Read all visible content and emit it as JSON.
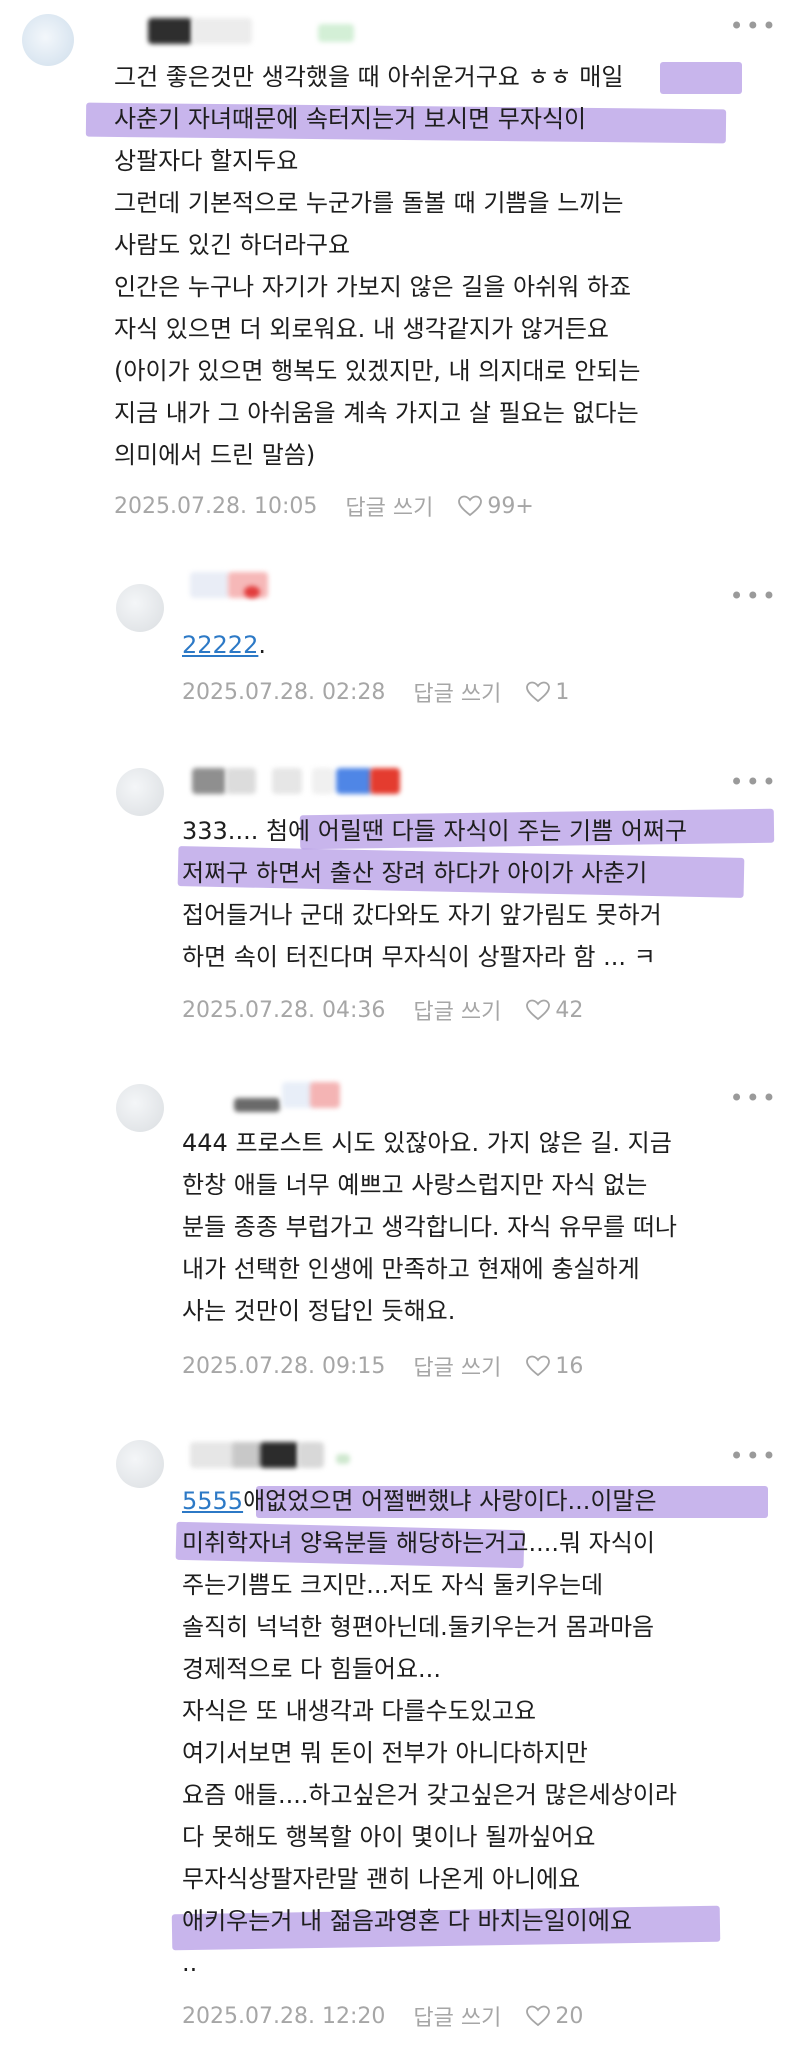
{
  "comments": [
    {
      "lines": [
        "그건 좋은것만 생각했을 때 아쉬운거구요 ㅎㅎ 매일",
        "사춘기 자녀때문에 속터지는거 보시면 무자식이",
        "상팔자다 할지두요",
        "그런데 기본적으로 누군가를 돌볼 때 기쁨을 느끼는",
        "사람도 있긴 하더라구요",
        "인간은 누구나 자기가 가보지 않은 길을 아쉬워 하죠",
        "자식 있으면 더 외로워요. 내 생각같지가 않거든요",
        "(아이가 있으면 행복도 있겠지만, 내 의지대로 안되는",
        "지금 내가 그 아쉬움을 계속 가지고 살 필요는 없다는",
        "의미에서 드린 말씀)"
      ],
      "date": "2025.07.28. 10:05",
      "reply": "답글 쓰기",
      "likes": "99+"
    },
    {
      "link": "22222",
      "lines": [
        "."
      ],
      "date": "2025.07.28. 02:28",
      "reply": "답글 쓰기",
      "likes": "1"
    },
    {
      "lines": [
        "333.... 첨에 어릴땐 다들 자식이 주는 기쁨 어쩌구",
        "저쩌구 하면서 출산 장려 하다가 아이가 사춘기",
        "접어들거나 군대 갔다와도 자기 앞가림도 못하거",
        "하면 속이 터진다며 무자식이 상팔자라 함 ... ㅋ"
      ],
      "date": "2025.07.28. 04:36",
      "reply": "답글 쓰기",
      "likes": "42"
    },
    {
      "lines": [
        "444 프로스트 시도 있잖아요. 가지 않은 길. 지금",
        "한창 애들 너무 예쁘고 사랑스럽지만 자식 없는",
        "분들 종종 부럽가고 생각합니다. 자식 유무를 떠나",
        "내가 선택한 인생에 만족하고 현재에 충실하게",
        "사는 것만이 정답인 듯해요."
      ],
      "date": "2025.07.28. 09:15",
      "reply": "답글 쓰기",
      "likes": "16"
    },
    {
      "link": "5555",
      "lines": [
        "애없었으면 어쩔뻔했냐 사랑이다...이말은",
        "미취학자녀 양육분들 해당하는거고....뭐 자식이",
        "주는기쁨도 크지만...저도 자식 둘키우는데",
        "솔직히 넉넉한 형편아닌데.둘키우는거 몸과마음",
        "경제적으로 다 힘들어요...",
        "자식은 또 내생각과 다를수도있고요",
        "여기서보면 뭐 돈이 전부가 아니다하지만",
        "요즘 애들....하고싶은거 갖고싶은거 많은세상이라",
        "다 못해도 행복할 아이 몇이나 될까싶어요",
        "무자식상팔자란말 괜히 나온게 아니에요",
        "애키우는거 내 젊음과영혼 다 바치는일이에요",
        ".."
      ],
      "date": "2025.07.28. 12:20",
      "reply": "답글 쓰기",
      "likes": "20"
    }
  ],
  "colors": {
    "highlight": "#9b78dd",
    "link": "#2c79c6",
    "meta": "#a6a6a6"
  },
  "icons": {
    "more": "more-dots-icon",
    "like": "heart-outline-icon"
  }
}
